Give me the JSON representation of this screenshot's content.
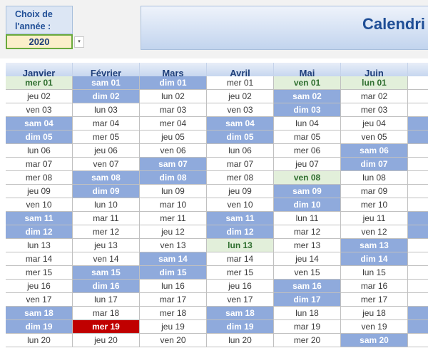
{
  "year_picker": {
    "label": "Choix de\nl'année :",
    "value": "2020",
    "dropdown_glyph": "▾"
  },
  "title": "Calendri",
  "months": [
    "Janvier",
    "Février",
    "Mars",
    "Avril",
    "Mai",
    "Juin",
    ""
  ],
  "colors": {
    "weekend": "#8faadc",
    "current": "#e2efda",
    "holiday": "#c00000",
    "header": "#b3c9ea",
    "title": "#1f4e96"
  },
  "calendar_rows": [
    [
      {
        "t": "mer 01",
        "s": "cur"
      },
      {
        "t": "sam 01",
        "s": "we"
      },
      {
        "t": "dim 01",
        "s": "we"
      },
      {
        "t": "mer 01",
        "s": ""
      },
      {
        "t": "ven 01",
        "s": "cur"
      },
      {
        "t": "lun 01",
        "s": "cur"
      },
      {
        "t": "",
        "s": ""
      }
    ],
    [
      {
        "t": "jeu 02",
        "s": ""
      },
      {
        "t": "dim 02",
        "s": "we"
      },
      {
        "t": "lun 02",
        "s": ""
      },
      {
        "t": "jeu 02",
        "s": ""
      },
      {
        "t": "sam 02",
        "s": "we"
      },
      {
        "t": "mar 02",
        "s": ""
      },
      {
        "t": "",
        "s": ""
      }
    ],
    [
      {
        "t": "ven 03",
        "s": ""
      },
      {
        "t": "lun 03",
        "s": ""
      },
      {
        "t": "mar 03",
        "s": ""
      },
      {
        "t": "ven 03",
        "s": ""
      },
      {
        "t": "dim 03",
        "s": "we"
      },
      {
        "t": "mer 03",
        "s": ""
      },
      {
        "t": "",
        "s": ""
      }
    ],
    [
      {
        "t": "sam 04",
        "s": "we"
      },
      {
        "t": "mar 04",
        "s": ""
      },
      {
        "t": "mer 04",
        "s": ""
      },
      {
        "t": "sam 04",
        "s": "we"
      },
      {
        "t": "lun 04",
        "s": ""
      },
      {
        "t": "jeu 04",
        "s": ""
      },
      {
        "t": "",
        "s": "we"
      }
    ],
    [
      {
        "t": "dim 05",
        "s": "we"
      },
      {
        "t": "mer 05",
        "s": ""
      },
      {
        "t": "jeu 05",
        "s": ""
      },
      {
        "t": "dim 05",
        "s": "we"
      },
      {
        "t": "mar 05",
        "s": ""
      },
      {
        "t": "ven 05",
        "s": ""
      },
      {
        "t": "",
        "s": "we"
      }
    ],
    [
      {
        "t": "lun 06",
        "s": ""
      },
      {
        "t": "jeu 06",
        "s": ""
      },
      {
        "t": "ven 06",
        "s": ""
      },
      {
        "t": "lun 06",
        "s": ""
      },
      {
        "t": "mer 06",
        "s": ""
      },
      {
        "t": "sam 06",
        "s": "we"
      },
      {
        "t": "",
        "s": ""
      }
    ],
    [
      {
        "t": "mar 07",
        "s": ""
      },
      {
        "t": "ven 07",
        "s": ""
      },
      {
        "t": "sam 07",
        "s": "we"
      },
      {
        "t": "mar 07",
        "s": ""
      },
      {
        "t": "jeu 07",
        "s": ""
      },
      {
        "t": "dim 07",
        "s": "we"
      },
      {
        "t": "",
        "s": ""
      }
    ],
    [
      {
        "t": "mer 08",
        "s": ""
      },
      {
        "t": "sam 08",
        "s": "we"
      },
      {
        "t": "dim 08",
        "s": "we"
      },
      {
        "t": "mer 08",
        "s": ""
      },
      {
        "t": "ven 08",
        "s": "cur"
      },
      {
        "t": "lun 08",
        "s": ""
      },
      {
        "t": "",
        "s": ""
      }
    ],
    [
      {
        "t": "jeu 09",
        "s": ""
      },
      {
        "t": "dim 09",
        "s": "we"
      },
      {
        "t": "lun 09",
        "s": ""
      },
      {
        "t": "jeu 09",
        "s": ""
      },
      {
        "t": "sam 09",
        "s": "we"
      },
      {
        "t": "mar 09",
        "s": ""
      },
      {
        "t": "",
        "s": ""
      }
    ],
    [
      {
        "t": "ven 10",
        "s": ""
      },
      {
        "t": "lun 10",
        "s": ""
      },
      {
        "t": "mar 10",
        "s": ""
      },
      {
        "t": "ven 10",
        "s": ""
      },
      {
        "t": "dim 10",
        "s": "we"
      },
      {
        "t": "mer 10",
        "s": ""
      },
      {
        "t": "",
        "s": ""
      }
    ],
    [
      {
        "t": "sam 11",
        "s": "we"
      },
      {
        "t": "mar 11",
        "s": ""
      },
      {
        "t": "mer 11",
        "s": ""
      },
      {
        "t": "sam 11",
        "s": "we"
      },
      {
        "t": "lun 11",
        "s": ""
      },
      {
        "t": "jeu 11",
        "s": ""
      },
      {
        "t": "",
        "s": "we"
      }
    ],
    [
      {
        "t": "dim 12",
        "s": "we"
      },
      {
        "t": "mer 12",
        "s": ""
      },
      {
        "t": "jeu 12",
        "s": ""
      },
      {
        "t": "dim 12",
        "s": "we"
      },
      {
        "t": "mar 12",
        "s": ""
      },
      {
        "t": "ven 12",
        "s": ""
      },
      {
        "t": "",
        "s": "we"
      }
    ],
    [
      {
        "t": "lun 13",
        "s": ""
      },
      {
        "t": "jeu 13",
        "s": ""
      },
      {
        "t": "ven 13",
        "s": ""
      },
      {
        "t": "lun 13",
        "s": "cur"
      },
      {
        "t": "mer 13",
        "s": ""
      },
      {
        "t": "sam 13",
        "s": "we"
      },
      {
        "t": "",
        "s": ""
      }
    ],
    [
      {
        "t": "mar 14",
        "s": ""
      },
      {
        "t": "ven 14",
        "s": ""
      },
      {
        "t": "sam 14",
        "s": "we"
      },
      {
        "t": "mar 14",
        "s": ""
      },
      {
        "t": "jeu 14",
        "s": ""
      },
      {
        "t": "dim 14",
        "s": "we"
      },
      {
        "t": "",
        "s": ""
      }
    ],
    [
      {
        "t": "mer 15",
        "s": ""
      },
      {
        "t": "sam 15",
        "s": "we"
      },
      {
        "t": "dim 15",
        "s": "we"
      },
      {
        "t": "mer 15",
        "s": ""
      },
      {
        "t": "ven 15",
        "s": ""
      },
      {
        "t": "lun 15",
        "s": ""
      },
      {
        "t": "",
        "s": ""
      }
    ],
    [
      {
        "t": "jeu 16",
        "s": ""
      },
      {
        "t": "dim 16",
        "s": "we"
      },
      {
        "t": "lun 16",
        "s": ""
      },
      {
        "t": "jeu 16",
        "s": ""
      },
      {
        "t": "sam 16",
        "s": "we"
      },
      {
        "t": "mar 16",
        "s": ""
      },
      {
        "t": "",
        "s": ""
      }
    ],
    [
      {
        "t": "ven 17",
        "s": ""
      },
      {
        "t": "lun 17",
        "s": ""
      },
      {
        "t": "mar 17",
        "s": ""
      },
      {
        "t": "ven 17",
        "s": ""
      },
      {
        "t": "dim 17",
        "s": "we"
      },
      {
        "t": "mer 17",
        "s": ""
      },
      {
        "t": "",
        "s": ""
      }
    ],
    [
      {
        "t": "sam 18",
        "s": "we"
      },
      {
        "t": "mar 18",
        "s": ""
      },
      {
        "t": "mer 18",
        "s": ""
      },
      {
        "t": "sam 18",
        "s": "we"
      },
      {
        "t": "lun 18",
        "s": ""
      },
      {
        "t": "jeu 18",
        "s": ""
      },
      {
        "t": "",
        "s": "we"
      }
    ],
    [
      {
        "t": "dim 19",
        "s": "we"
      },
      {
        "t": "mer 19",
        "s": "hol"
      },
      {
        "t": "jeu 19",
        "s": ""
      },
      {
        "t": "dim 19",
        "s": "we"
      },
      {
        "t": "mar 19",
        "s": ""
      },
      {
        "t": "ven 19",
        "s": ""
      },
      {
        "t": "",
        "s": "we"
      }
    ],
    [
      {
        "t": "lun 20",
        "s": ""
      },
      {
        "t": "jeu 20",
        "s": ""
      },
      {
        "t": "ven 20",
        "s": ""
      },
      {
        "t": "lun 20",
        "s": ""
      },
      {
        "t": "mer 20",
        "s": ""
      },
      {
        "t": "sam 20",
        "s": "we"
      },
      {
        "t": "",
        "s": ""
      }
    ]
  ]
}
